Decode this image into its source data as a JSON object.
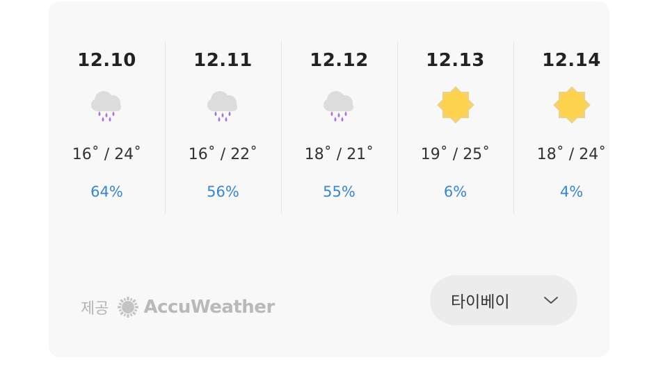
{
  "forecast": [
    {
      "date": "12.10",
      "icon": "rain-cloud-icon",
      "temps": "16˚ / 24˚",
      "precip": "64%"
    },
    {
      "date": "12.11",
      "icon": "rain-cloud-icon",
      "temps": "16˚ / 22˚",
      "precip": "56%"
    },
    {
      "date": "12.12",
      "icon": "rain-cloud-icon",
      "temps": "18˚ / 21˚",
      "precip": "55%"
    },
    {
      "date": "12.13",
      "icon": "sun-icon",
      "temps": "19˚ / 25˚",
      "precip": "6%"
    },
    {
      "date": "12.14",
      "icon": "sun-icon",
      "temps": "18˚ / 24˚",
      "precip": "4%"
    }
  ],
  "provider": {
    "label": "제공",
    "name": "AccuWeather",
    "icon": "accuweather-logo-icon"
  },
  "location": {
    "selected": "타이베이",
    "icon": "chevron-down-icon"
  },
  "colors": {
    "precip": "#3a86c8",
    "sun": "#fdd34d",
    "rain": "#a872e0",
    "cloud": "#dcdcdc"
  }
}
